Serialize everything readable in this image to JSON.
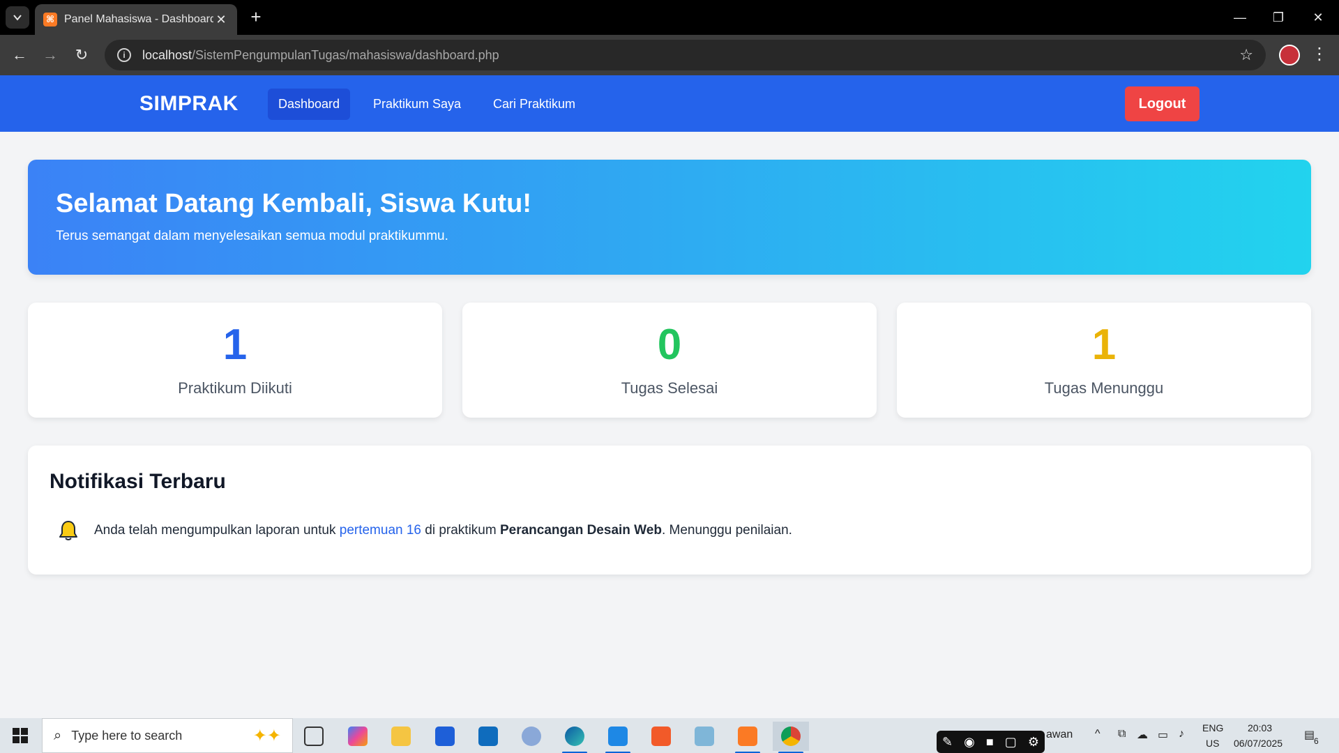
{
  "browser": {
    "tab_title": "Panel Mahasiswa - Dashboard",
    "favicon_label": "⌘",
    "url_host": "localhost",
    "url_path": "/SistemPengumpulanTugas/mahasiswa/dashboard.php"
  },
  "nav": {
    "brand": "SIMPRAK",
    "links": [
      "Dashboard",
      "Praktikum Saya",
      "Cari Praktikum"
    ],
    "active_index": 0,
    "logout_label": "Logout"
  },
  "hero": {
    "title": "Selamat Datang Kembali, Siswa Kutu!",
    "subtitle": "Terus semangat dalam menyelesaikan semua modul praktikummu."
  },
  "stats": [
    {
      "value": "1",
      "label": "Praktikum Diikuti",
      "color": "#2563eb"
    },
    {
      "value": "0",
      "label": "Tugas Selesai",
      "color": "#22c55e"
    },
    {
      "value": "1",
      "label": "Tugas Menunggu",
      "color": "#eab308"
    }
  ],
  "notifications": {
    "title": "Notifikasi Terbaru",
    "item": {
      "prefix": "Anda telah mengumpulkan laporan untuk ",
      "link": "pertemuan 16",
      "middle": " di praktikum ",
      "course": "Perancangan Desain Web",
      "suffix": ". Menunggu penilaian."
    }
  },
  "taskbar": {
    "search_placeholder": "Type here to search",
    "tray_user_fragment": "awan",
    "lang": "ENG",
    "region": "US",
    "time": "20:03",
    "date": "06/07/2025",
    "notif_count": "6"
  },
  "colors": {
    "nav_bg": "#2563eb",
    "logout_bg": "#ef4444",
    "hero_from": "#3b82f6",
    "hero_to": "#22d3ee"
  }
}
